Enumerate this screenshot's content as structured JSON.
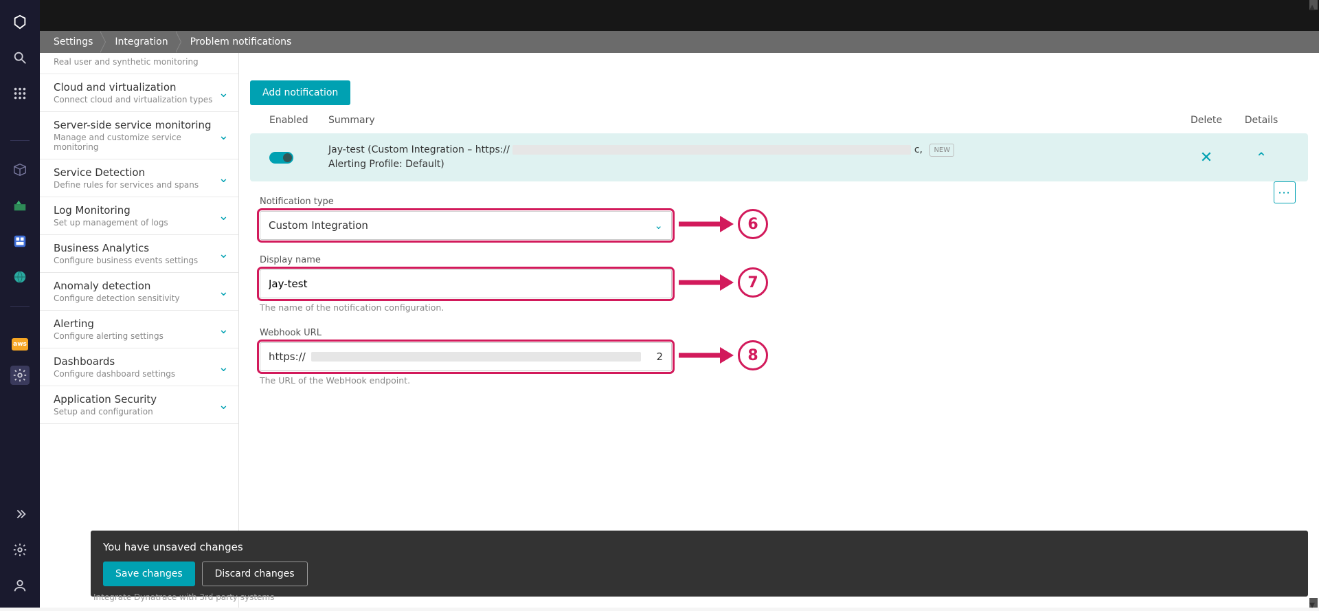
{
  "breadcrumbs": {
    "a": "Settings",
    "b": "Integration",
    "c": "Problem notifications"
  },
  "sidebar": {
    "partial_top": "Real user and synthetic monitoring",
    "items": [
      {
        "title": "Cloud and virtualization",
        "desc": "Connect cloud and virtualization types"
      },
      {
        "title": "Server-side service monitoring",
        "desc": "Manage and customize service monitoring"
      },
      {
        "title": "Service Detection",
        "desc": "Define rules for services and spans"
      },
      {
        "title": "Log Monitoring",
        "desc": "Set up management of logs"
      },
      {
        "title": "Business Analytics",
        "desc": "Configure business events settings"
      },
      {
        "title": "Anomaly detection",
        "desc": "Configure detection sensitivity"
      },
      {
        "title": "Alerting",
        "desc": "Configure alerting settings"
      },
      {
        "title": "Dashboards",
        "desc": "Configure dashboard settings"
      },
      {
        "title": "Application Security",
        "desc": "Setup and configuration"
      }
    ]
  },
  "content": {
    "add_btn": "Add notification",
    "headers": {
      "enabled": "Enabled",
      "summary": "Summary",
      "delete": "Delete",
      "details": "Details"
    },
    "row": {
      "line1_prefix": "Jay-test (Custom Integration – https://",
      "line1_suffix": "c,",
      "new_badge": "NEW",
      "line2": "Alerting Profile: Default)"
    },
    "form": {
      "type_label": "Notification type",
      "type_value": "Custom Integration",
      "name_label": "Display name",
      "name_value": "Jay-test",
      "name_help": "The name of the notification configuration.",
      "url_label": "Webhook URL",
      "url_prefix": "https://",
      "url_suffix": "2",
      "url_help": "The URL of the WebHook endpoint."
    }
  },
  "annotations": {
    "six": "6",
    "seven": "7",
    "eight": "8"
  },
  "unsaved": {
    "msg": "You have unsaved changes",
    "save": "Save changes",
    "discard": "Discard changes"
  },
  "integrate_peek": "Integrate Dynatrace with 3rd party systems",
  "aws_label": "aws"
}
